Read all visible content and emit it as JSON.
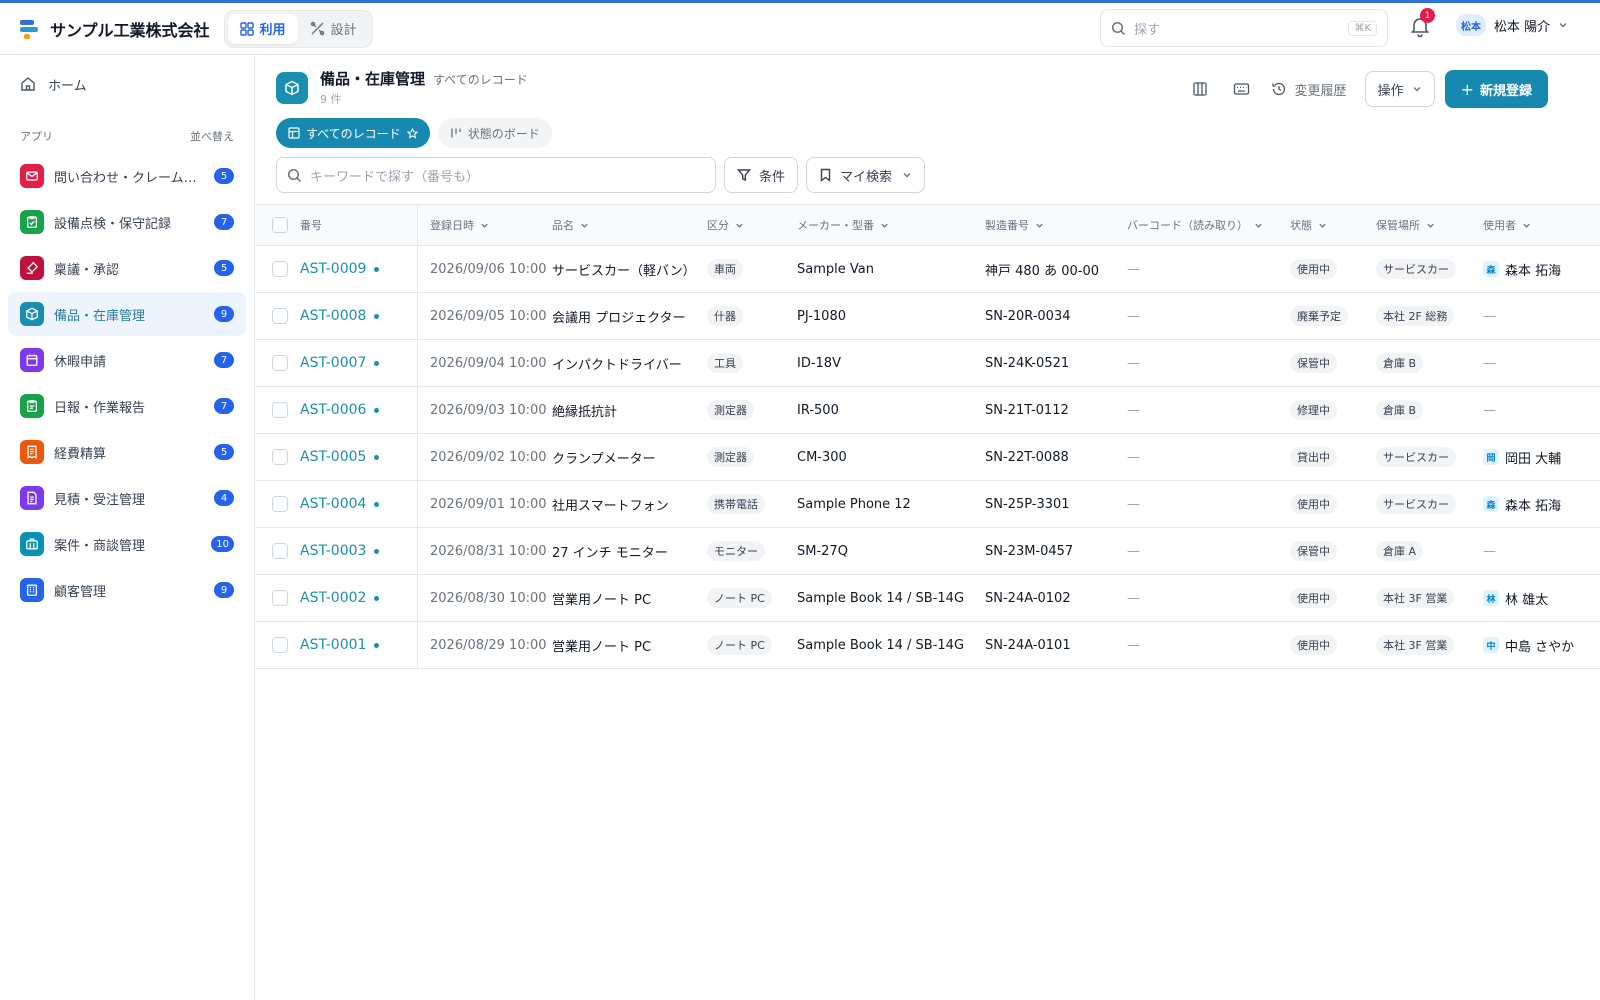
{
  "brand": {
    "name": "サンプル工業株式会社"
  },
  "modes": [
    {
      "label": "利用",
      "active": true
    },
    {
      "label": "設計",
      "active": false
    }
  ],
  "search": {
    "placeholder": "探す",
    "shortcut": "⌘K"
  },
  "notifications": {
    "count": "1"
  },
  "user": {
    "avatar": "松本",
    "name": "松本 陽介"
  },
  "sidebar": {
    "home": "ホーム",
    "apps_heading": "アプリ",
    "sort_label": "並べ替え",
    "apps": [
      {
        "label": "問い合わせ・クレーム管…",
        "count": "5",
        "color": "#e11d48",
        "icon": "mail-icon"
      },
      {
        "label": "設備点検・保守記録",
        "count": "7",
        "color": "#16a34a",
        "icon": "clipboard-check-icon"
      },
      {
        "label": "稟議・承認",
        "count": "5",
        "color": "#be123c",
        "icon": "stamp-icon"
      },
      {
        "label": "備品・在庫管理",
        "count": "9",
        "color": "#1b8fb0",
        "icon": "box-icon",
        "active": true
      },
      {
        "label": "休暇申請",
        "count": "7",
        "color": "#7c3aed",
        "icon": "calendar-icon"
      },
      {
        "label": "日報・作業報告",
        "count": "7",
        "color": "#16a34a",
        "icon": "clipboard-icon"
      },
      {
        "label": "経費精算",
        "count": "5",
        "color": "#ea580c",
        "icon": "receipt-icon"
      },
      {
        "label": "見積・受注管理",
        "count": "4",
        "color": "#7c3aed",
        "icon": "document-icon"
      },
      {
        "label": "案件・商談管理",
        "count": "10",
        "color": "#0891b2",
        "icon": "briefcase-icon"
      },
      {
        "label": "顧客管理",
        "count": "9",
        "color": "#2563eb",
        "icon": "building-icon"
      }
    ]
  },
  "page": {
    "title": "備品・在庫管理",
    "subtitle": "すべてのレコード",
    "count": "9 件",
    "history": "変更履歴",
    "ops": "操作",
    "new": "新規登録",
    "views": [
      {
        "label": "すべてのレコード",
        "active": true
      },
      {
        "label": "状態のボード",
        "active": false
      }
    ],
    "keyword_placeholder": "キーワードで探す（番号も）",
    "filter": "条件",
    "my_search": "マイ検索"
  },
  "table": {
    "headers": {
      "no": "番号",
      "date": "登録日時",
      "name": "品名",
      "kubun": "区分",
      "maker": "メーカー・型番",
      "serial": "製造番号",
      "barcode": "バーコード（読み取り）",
      "state": "状態",
      "place": "保管場所",
      "user": "使用者"
    },
    "rows": [
      {
        "no": "AST-0009",
        "date": "2026/09/06 10:00",
        "name": "サービスカー（軽バン）",
        "kubun": "車両",
        "maker": "Sample Van",
        "serial": "神戸 480 あ 00-00",
        "barcode": "—",
        "state": "使用中",
        "place": "サービスカー",
        "user_av": "森",
        "user": "森本 拓海"
      },
      {
        "no": "AST-0008",
        "date": "2026/09/05 10:00",
        "name": "会議用 プロジェクター",
        "kubun": "什器",
        "maker": "PJ-1080",
        "serial": "SN-20R-0034",
        "barcode": "—",
        "state": "廃棄予定",
        "place": "本社 2F 総務",
        "user_av": "",
        "user": "—"
      },
      {
        "no": "AST-0007",
        "date": "2026/09/04 10:00",
        "name": "インパクトドライバー",
        "kubun": "工具",
        "maker": "ID-18V",
        "serial": "SN-24K-0521",
        "barcode": "—",
        "state": "保管中",
        "place": "倉庫 B",
        "user_av": "",
        "user": "—"
      },
      {
        "no": "AST-0006",
        "date": "2026/09/03 10:00",
        "name": "絶縁抵抗計",
        "kubun": "測定器",
        "maker": "IR-500",
        "serial": "SN-21T-0112",
        "barcode": "—",
        "state": "修理中",
        "place": "倉庫 B",
        "user_av": "",
        "user": "—"
      },
      {
        "no": "AST-0005",
        "date": "2026/09/02 10:00",
        "name": "クランプメーター",
        "kubun": "測定器",
        "maker": "CM-300",
        "serial": "SN-22T-0088",
        "barcode": "—",
        "state": "貸出中",
        "place": "サービスカー",
        "user_av": "岡",
        "user": "岡田 大輔"
      },
      {
        "no": "AST-0004",
        "date": "2026/09/01 10:00",
        "name": "社用スマートフォン",
        "kubun": "携帯電話",
        "maker": "Sample Phone 12",
        "serial": "SN-25P-3301",
        "barcode": "—",
        "state": "使用中",
        "place": "サービスカー",
        "user_av": "森",
        "user": "森本 拓海"
      },
      {
        "no": "AST-0003",
        "date": "2026/08/31 10:00",
        "name": "27 インチ モニター",
        "kubun": "モニター",
        "maker": "SM-27Q",
        "serial": "SN-23M-0457",
        "barcode": "—",
        "state": "保管中",
        "place": "倉庫 A",
        "user_av": "",
        "user": "—"
      },
      {
        "no": "AST-0002",
        "date": "2026/08/30 10:00",
        "name": "営業用ノート PC",
        "kubun": "ノート PC",
        "maker": "Sample Book 14 / SB-14G",
        "serial": "SN-24A-0102",
        "barcode": "—",
        "state": "使用中",
        "place": "本社 3F 営業",
        "user_av": "林",
        "user": "林 雄太"
      },
      {
        "no": "AST-0001",
        "date": "2026/08/29 10:00",
        "name": "営業用ノート PC",
        "kubun": "ノート PC",
        "maker": "Sample Book 14 / SB-14G",
        "serial": "SN-24A-0101",
        "barcode": "—",
        "state": "使用中",
        "place": "本社 3F 営業",
        "user_av": "中",
        "user": "中島 さやか"
      }
    ]
  }
}
